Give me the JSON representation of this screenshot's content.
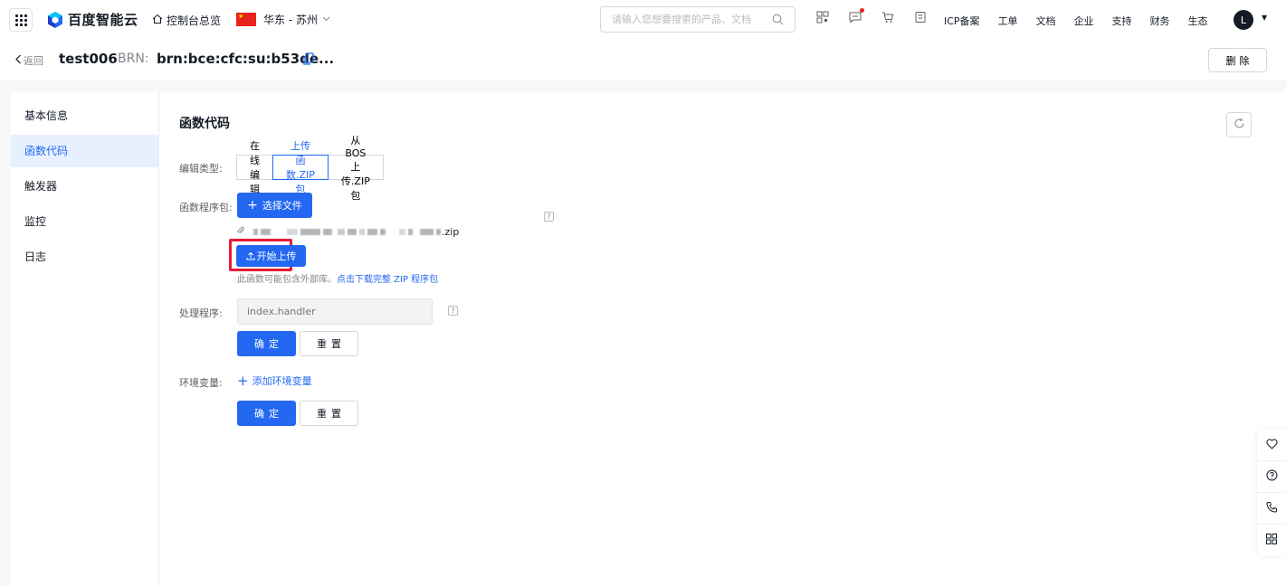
{
  "topbar": {
    "brand": "百度智能云",
    "console_home": "控制台总览",
    "region": "华东 - 苏州",
    "search_placeholder": "请输入您想要搜索的产品、文档",
    "links": [
      "ICP备案",
      "工单",
      "文档",
      "企业",
      "支持",
      "财务",
      "生态"
    ],
    "avatar_letter": "L"
  },
  "subbar": {
    "back_label": "返回",
    "function_name": "test006",
    "brn_label": "BRN:",
    "brn_value": "brn:bce:cfc:su:b53de...",
    "delete_label": "删除"
  },
  "sidebar": {
    "items": [
      "基本信息",
      "函数代码",
      "触发器",
      "监控",
      "日志"
    ],
    "active_index": 1
  },
  "main": {
    "section_title": "函数代码",
    "edit_type_label": "编辑类型:",
    "edit_types": [
      "在线编辑",
      "上传函数.ZIP包",
      "从BOS上传.ZIP包"
    ],
    "selected_edit_type": 1,
    "package_label": "函数程序包:",
    "choose_file_label": "选择文件",
    "file_ext": ".zip",
    "start_upload_label": "开始上传",
    "note_text": "此函数可能包含外部库。",
    "note_link": "点击下载完整 ZIP 程序包",
    "handler_label": "处理程序:",
    "handler_placeholder": "index.handler",
    "confirm_label": "确定",
    "reset_label": "重置",
    "env_label": "环境变量:",
    "add_env_label": "添加环境变量",
    "help_glyph": "?"
  },
  "colors": {
    "primary": "#2468f2",
    "highlight_box": "#e81b37",
    "active_bg": "#e6f0ff"
  }
}
